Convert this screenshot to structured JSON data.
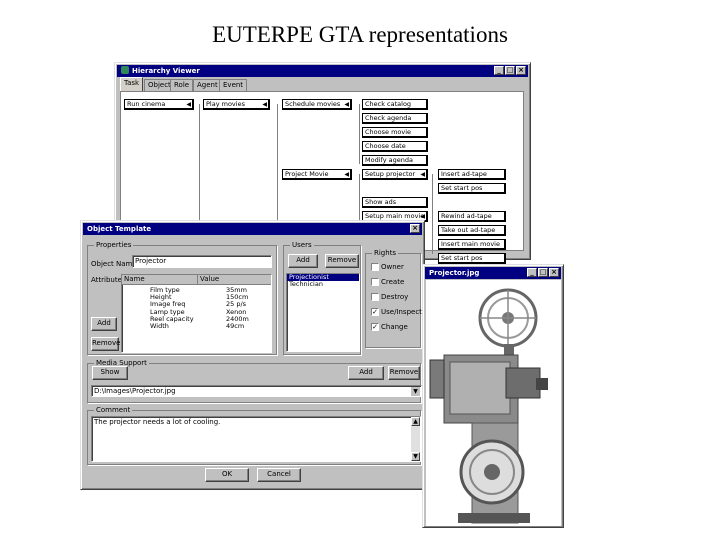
{
  "slide": {
    "title": "EUTERPE GTA representations"
  },
  "hierarchy": {
    "title": "Hierarchy Viewer",
    "tabs": [
      "Task",
      "Object",
      "Role",
      "Agent",
      "Event"
    ],
    "nodes": [
      {
        "label": "Run cinema",
        "arrow": true
      },
      {
        "label": "Play movies",
        "arrow": true
      },
      {
        "label": "Schedule movies",
        "arrow": true
      },
      {
        "label": "Check catalog",
        "arrow": false
      },
      {
        "label": "Check agenda",
        "arrow": false
      },
      {
        "label": "Choose movie",
        "arrow": false
      },
      {
        "label": "Choose date",
        "arrow": false
      },
      {
        "label": "Modify agenda",
        "arrow": false
      },
      {
        "label": "Project Movie",
        "arrow": true
      },
      {
        "label": "Setup projector",
        "arrow": true
      },
      {
        "label": "Insert ad-tape",
        "arrow": false
      },
      {
        "label": "Set start pos",
        "arrow": false
      },
      {
        "label": "Show ads",
        "arrow": false
      },
      {
        "label": "Setup main movie",
        "arrow": true
      },
      {
        "label": "Rewind ad-tape",
        "arrow": false
      },
      {
        "label": "Take out ad-tape",
        "arrow": false
      },
      {
        "label": "Insert main movie",
        "arrow": false
      },
      {
        "label": "Set start pos",
        "arrow": false
      }
    ]
  },
  "object_template": {
    "title": "Object Template",
    "properties_label": "Properties",
    "object_name_label": "Object Name",
    "object_name_value": "Projector",
    "attributes_label": "Attributes",
    "col_name": "Name",
    "col_value": "Value",
    "attributes": [
      {
        "name": "Film type",
        "value": "35mm"
      },
      {
        "name": "Height",
        "value": "150cm"
      },
      {
        "name": "Image freq",
        "value": "25 p/s"
      },
      {
        "name": "Lamp type",
        "value": "Xenon"
      },
      {
        "name": "Reel capacity",
        "value": "2400m"
      },
      {
        "name": "Width",
        "value": "49cm"
      }
    ],
    "add_attr": "Add",
    "remove_attr": "Remove",
    "users_label": "Users",
    "add_user": "Add",
    "remove_user": "Remove",
    "users": [
      {
        "name": "Projectionist",
        "selected": true
      },
      {
        "name": "Technician",
        "selected": false
      }
    ],
    "rights_label": "Rights",
    "rights": [
      {
        "label": "Owner",
        "checked": false
      },
      {
        "label": "Create",
        "checked": false
      },
      {
        "label": "Destroy",
        "checked": false
      },
      {
        "label": "Use/Inspect",
        "checked": true
      },
      {
        "label": "Change",
        "checked": true
      }
    ],
    "media_label": "Media Support",
    "show_btn": "Show",
    "media_add": "Add",
    "media_remove": "Remove",
    "media_path": "D:\\Images\\Projector.jpg",
    "comment_label": "Comment",
    "comment_text": "The projector needs a lot of cooling.",
    "ok": "OK",
    "cancel": "Cancel",
    "check_glyph": "✓",
    "close_glyph": "×"
  },
  "image_window": {
    "title": "Projector.jpg"
  },
  "window_buttons": {
    "minimize": "_",
    "maximize": "□",
    "close": "×"
  },
  "icons": {
    "dropdown": "▼",
    "node_arrow": "◀",
    "scroll_up": "▲",
    "scroll_down": "▼"
  }
}
